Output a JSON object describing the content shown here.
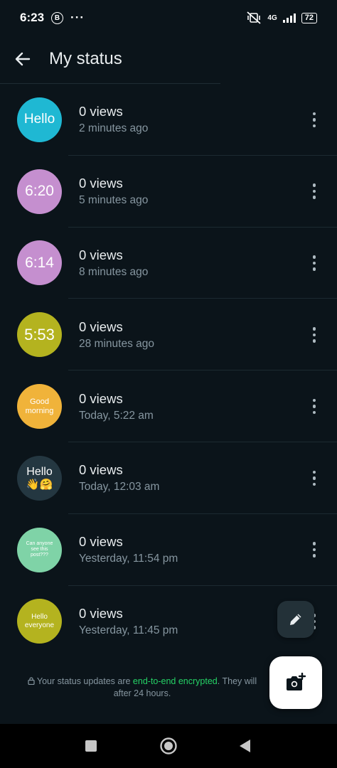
{
  "status_bar": {
    "time": "6:23",
    "notification_icon": "b-circle-icon",
    "overflow_dots": "···",
    "network": "4G",
    "battery": "72"
  },
  "app_bar": {
    "back_icon": "arrow-back-icon",
    "title": "My status"
  },
  "statuses": [
    {
      "thumb_text": "Hello",
      "thumb_color": "#1fb8d3",
      "views": "0 views",
      "time": "2 minutes ago"
    },
    {
      "thumb_text": "6:20",
      "thumb_color": "#c58fcf",
      "views": "0 views",
      "time": "5 minutes ago"
    },
    {
      "thumb_text": "6:14",
      "thumb_color": "#c58fcf",
      "views": "0 views",
      "time": "8 minutes ago"
    },
    {
      "thumb_text": "5:53",
      "thumb_color": "#b4b31f",
      "views": "0 views",
      "time": "28 minutes ago"
    },
    {
      "thumb_text": "Good morning",
      "thumb_color": "#f0b33a",
      "views": "0 views",
      "time": "Today, 5:22 am"
    },
    {
      "thumb_text": "Hello",
      "thumb_emoji": "👋🤗",
      "thumb_color": "#243741",
      "views": "0 views",
      "time": "Today, 12:03 am"
    },
    {
      "thumb_text": "Can anyone see this post???",
      "thumb_color": "#7fd3a7",
      "views": "0 views",
      "time": "Yesterday, 11:54 pm"
    },
    {
      "thumb_text": "Hello everyone",
      "thumb_color": "#b4b31f",
      "views": "0 views",
      "time": "Yesterday, 11:45 pm"
    }
  ],
  "footer": {
    "prefix": "Your status updates are ",
    "encrypted": "end-to-end encrypted",
    "suffix": ". They will",
    "line2": "after 24 hours."
  },
  "fabs": {
    "edit_icon": "pencil-icon",
    "camera_icon": "camera-plus-icon"
  },
  "colors": {
    "background": "#0b141a",
    "accent": "#25d366",
    "secondary_text": "#8696a0"
  }
}
